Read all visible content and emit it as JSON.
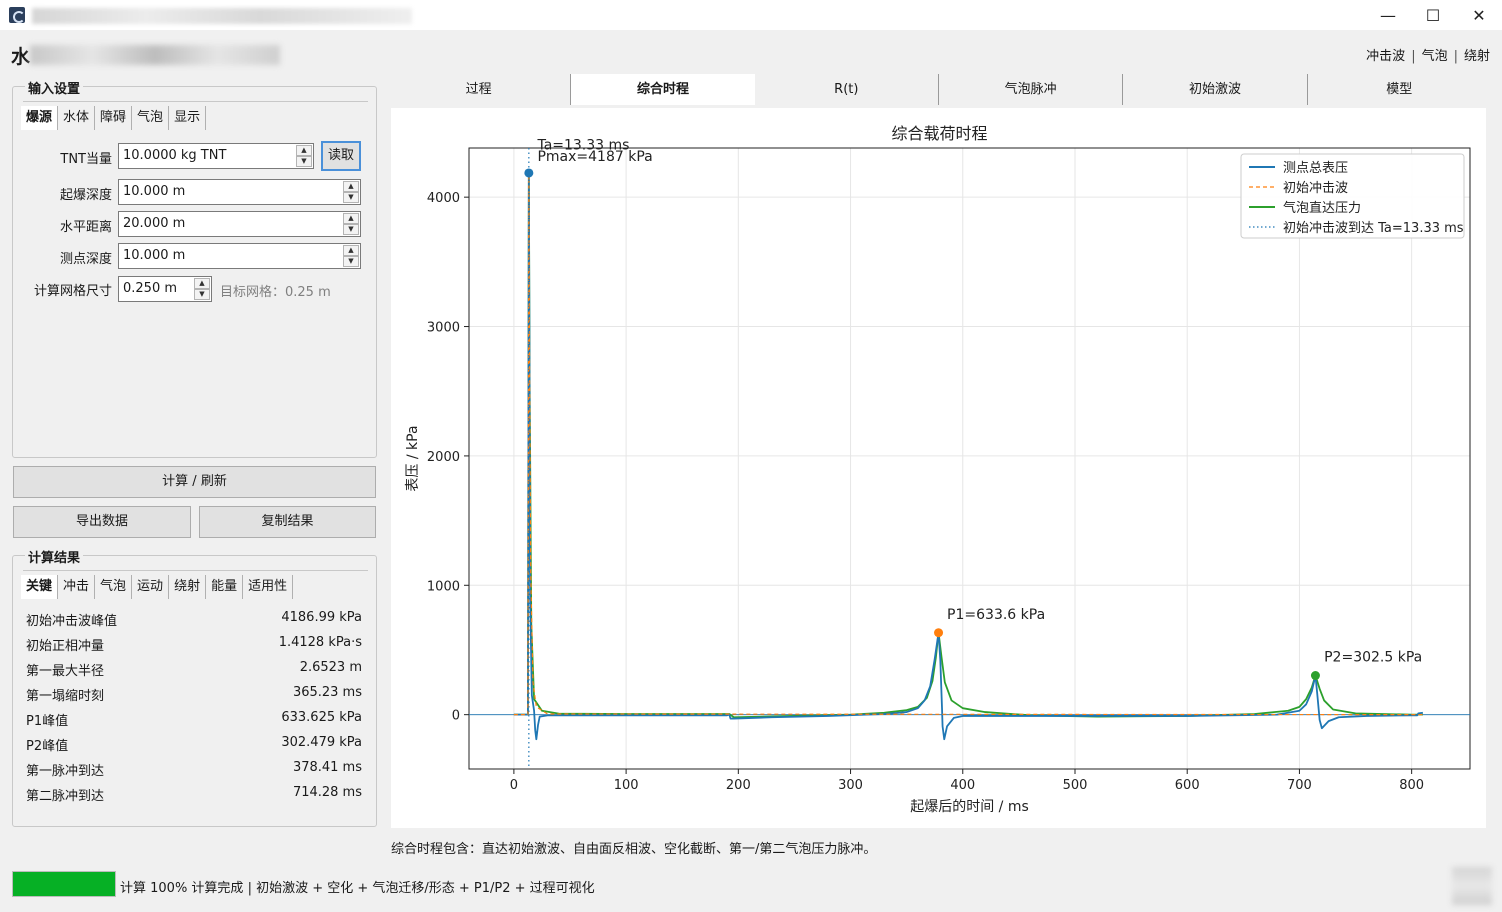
{
  "window": {
    "minimize_glyph": "—",
    "maximize_glyph": "☐",
    "close_glyph": "✕"
  },
  "header": {
    "app_title_first_char": "水",
    "links": [
      "冲击波",
      "气泡",
      "绕射"
    ]
  },
  "input_settings": {
    "title": "输入设置",
    "tabs": [
      "爆源",
      "水体",
      "障碍",
      "气泡",
      "显示"
    ],
    "active_tab": "爆源",
    "fields": {
      "tnt": {
        "label": "TNT当量",
        "value": "10.0000 kg TNT"
      },
      "depth": {
        "label": "起爆深度",
        "value": "10.000 m"
      },
      "distance": {
        "label": "水平距离",
        "value": "20.000 m"
      },
      "gauge_depth": {
        "label": "测点深度",
        "value": "10.000 m"
      },
      "grid": {
        "label": "计算网格尺寸",
        "value": "0.250 m"
      }
    },
    "read_button": "读取",
    "grid_hint": "目标网格：0.25 m"
  },
  "actions": {
    "compute": "计算 / 刷新",
    "export": "导出数据",
    "copy": "复制结果"
  },
  "results": {
    "title": "计算结果",
    "tabs": [
      "关键",
      "冲击",
      "气泡",
      "运动",
      "绕射",
      "能量",
      "适用性"
    ],
    "active_tab": "关键",
    "rows": [
      {
        "k": "初始冲击波峰值",
        "v": "4186.99 kPa"
      },
      {
        "k": "初始正相冲量",
        "v": "1.4128 kPa·s"
      },
      {
        "k": "第一最大半径",
        "v": "2.6523 m"
      },
      {
        "k": "第一塌缩时刻",
        "v": "365.23 ms"
      },
      {
        "k": "P1峰值",
        "v": "633.625 kPa"
      },
      {
        "k": "P2峰值",
        "v": "302.479 kPa"
      },
      {
        "k": "第一脉冲到达",
        "v": "378.41 ms"
      },
      {
        "k": "第二脉冲到达",
        "v": "714.28 ms"
      }
    ]
  },
  "main_tabs": [
    "过程",
    "综合时程",
    "R(t)",
    "气泡脉冲",
    "初始激波",
    "模型"
  ],
  "main_active_tab": "综合时程",
  "chart_data": {
    "type": "line",
    "title": "综合载荷时程",
    "xlabel": "起爆后的时间 / ms",
    "ylabel": "表压 / kPa",
    "xlim": [
      -40,
      852
    ],
    "ylim": [
      -420,
      4380
    ],
    "xticks": [
      0,
      100,
      200,
      300,
      400,
      500,
      600,
      700,
      800
    ],
    "yticks": [
      0,
      1000,
      2000,
      3000,
      4000
    ],
    "grid": true,
    "legend_position": "top-right",
    "series": [
      {
        "name": "测点总表压",
        "color": "#1f77b4",
        "style": "solid",
        "x": [
          0,
          12.5,
          13.33,
          13.8,
          14.5,
          16,
          18,
          19,
          20,
          21.5,
          23,
          30,
          60,
          100,
          150,
          190,
          192,
          193,
          196,
          230,
          280,
          330,
          350,
          360,
          366,
          371,
          375,
          378.41,
          380,
          381.5,
          382,
          383.5,
          386,
          392,
          400,
          430,
          500,
          600,
          680,
          700,
          706,
          711,
          714.28,
          716,
          718,
          720,
          726,
          735,
          760,
          800,
          805,
          806,
          810
        ],
        "y": [
          0,
          0,
          4187,
          3000,
          900,
          150,
          30,
          -120,
          -190,
          -80,
          -15,
          -5,
          -5,
          -5,
          -5,
          -5,
          0,
          -30,
          -30,
          -20,
          -10,
          5,
          20,
          50,
          110,
          220,
          430,
          633.6,
          420,
          50,
          -90,
          -190,
          -90,
          -25,
          -10,
          -10,
          -10,
          -10,
          0,
          30,
          80,
          180,
          302.5,
          150,
          -40,
          -105,
          -50,
          -20,
          -10,
          -5,
          -5,
          10,
          15
        ]
      },
      {
        "name": "初始冲击波",
        "color": "#ff7f0e",
        "style": "dashed",
        "x": [
          0,
          12.5,
          13.33,
          14,
          15,
          17,
          20,
          30,
          810
        ],
        "y": [
          0,
          0,
          4187,
          2600,
          1100,
          250,
          60,
          5,
          0
        ]
      },
      {
        "name": "气泡直达压力",
        "color": "#2ca02c",
        "style": "solid",
        "x": [
          0,
          12.5,
          13.33,
          14,
          15.5,
          18,
          25,
          40,
          100,
          192,
          196,
          250,
          300,
          330,
          350,
          360,
          368,
          373,
          376,
          378.41,
          381,
          384,
          390,
          400,
          420,
          460,
          520,
          600,
          660,
          690,
          700,
          706,
          711,
          714.28,
          718,
          722,
          730,
          750,
          800,
          810
        ],
        "y": [
          0,
          0,
          4187,
          2600,
          700,
          120,
          30,
          8,
          5,
          5,
          -20,
          -10,
          0,
          15,
          35,
          60,
          130,
          260,
          440,
          633.6,
          450,
          250,
          110,
          50,
          20,
          -5,
          -15,
          -10,
          5,
          30,
          60,
          120,
          210,
          302.5,
          200,
          110,
          40,
          10,
          0,
          0
        ]
      },
      {
        "name": "初始冲击波到达 Ta=13.33 ms",
        "color": "#1f77b4",
        "style": "dotted",
        "vline": 13.33
      }
    ],
    "markers": [
      {
        "x": 13.33,
        "y": 4187,
        "color": "#1f77b4"
      },
      {
        "x": 378.41,
        "y": 633.6,
        "color": "#ff7f0e"
      },
      {
        "x": 714.28,
        "y": 302.5,
        "color": "#2ca02c"
      }
    ],
    "annotations": [
      {
        "text": "Ta=13.33 ms",
        "x": 21,
        "y": 4370
      },
      {
        "text": "Pmax=4187 kPa",
        "x": 21,
        "y": 4280
      },
      {
        "text": "P1=633.6 kPa",
        "x": 386,
        "y": 740
      },
      {
        "text": "P2=302.5 kPa",
        "x": 722,
        "y": 410
      }
    ]
  },
  "caption": "综合时程包含：直达初始激波、自由面反相波、空化截断、第一/第二气泡压力脉冲。",
  "status": {
    "progress": 100,
    "text": "计算 100%  计算完成 | 初始激波 + 空化 + 气泡迁移/形态 + P1/P2 + 过程可视化"
  }
}
